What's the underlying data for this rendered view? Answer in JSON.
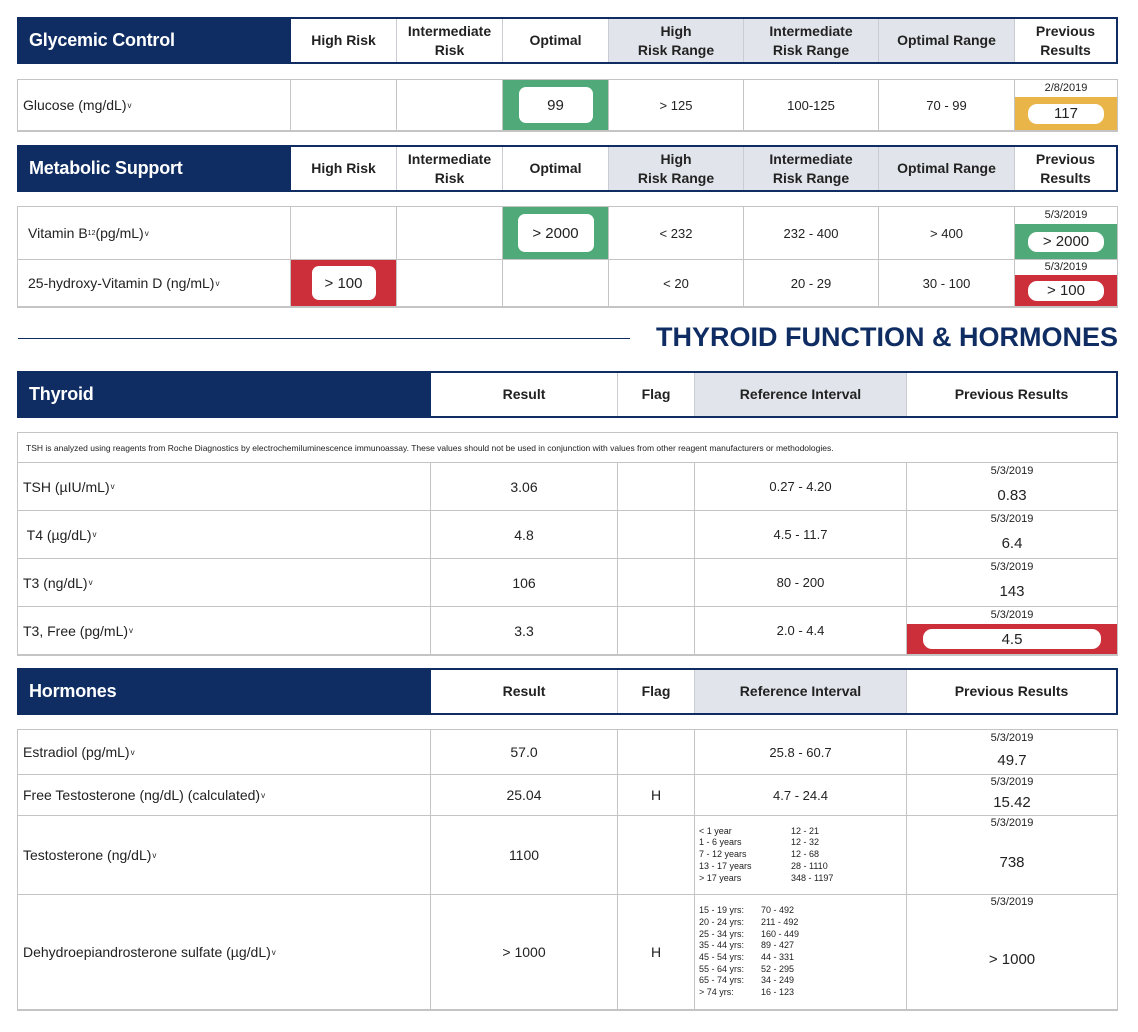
{
  "glycemic": {
    "title": "Glycemic Control",
    "headers": [
      "High Risk",
      "Intermediate\nRisk",
      "Optimal",
      "High\nRisk Range",
      "Intermediate\nRisk Range",
      "Optimal Range",
      "Previous\nResults"
    ],
    "rows": [
      {
        "name": "Glucose (mg/dL)",
        "sup": "v",
        "category": "Optimal",
        "value": "99",
        "high_range": "> 125",
        "intermediate_range": "100-125",
        "optimal_range": "70 - 99",
        "prev_date": "2/8/2019",
        "prev_value": "117",
        "prev_status": "intermediate"
      }
    ]
  },
  "metabolic": {
    "title": "Metabolic Support",
    "headers": [
      "High Risk",
      "Intermediate\nRisk",
      "Optimal",
      "High\nRisk Range",
      "Intermediate\nRisk Range",
      "Optimal Range",
      "Previous\nResults"
    ],
    "rows": [
      {
        "name": "Vitamin B",
        "sub": "12",
        "unit": " (pg/mL)",
        "sup": "v",
        "category": "Optimal",
        "value": "> 2000",
        "high_range": "< 232",
        "intermediate_range": "232 - 400",
        "optimal_range": "> 400",
        "prev_date": "5/3/2019",
        "prev_value": "> 2000",
        "prev_status": "optimal"
      },
      {
        "name": "25-hydroxy-Vitamin D (ng/mL)",
        "sup": "v",
        "category": "High Risk",
        "value": "> 100",
        "high_range": "< 20",
        "intermediate_range": "20 - 29",
        "optimal_range": "30 - 100",
        "prev_date": "5/3/2019",
        "prev_value": "> 100",
        "prev_status": "high"
      }
    ]
  },
  "section_heading": "THYROID FUNCTION & HORMONES",
  "thyroid": {
    "title": "Thyroid",
    "headers": [
      "Result",
      "Flag",
      "Reference Interval",
      "Previous Results"
    ],
    "note": "TSH is analyzed using reagents from Roche Diagnostics by electrochemiluminescence immunoassay. These values should not be used in conjunction with values from other reagent manufacturers or methodologies.",
    "rows": [
      {
        "name": "TSH (µIU/mL)",
        "sup": "v",
        "result": "3.06",
        "flag": "",
        "reference": "0.27 - 4.20",
        "prev_date": "5/3/2019",
        "prev_value": "0.83",
        "prev_status": "normal"
      },
      {
        "name": " T4 (µg/dL)",
        "sup": "v",
        "result": "4.8",
        "flag": "",
        "reference": "4.5 - 11.7",
        "prev_date": "5/3/2019",
        "prev_value": "6.4",
        "prev_status": "normal"
      },
      {
        "name": "T3 (ng/dL)",
        "sup": "v",
        "result": "106",
        "flag": "",
        "reference": "80 - 200",
        "prev_date": "5/3/2019",
        "prev_value": "143",
        "prev_status": "normal"
      },
      {
        "name": "T3, Free (pg/mL)",
        "sup": "v",
        "result": "3.3",
        "flag": "",
        "reference": "2.0 - 4.4",
        "prev_date": "5/3/2019",
        "prev_value": "4.5",
        "prev_status": "high"
      }
    ]
  },
  "hormones": {
    "title": "Hormones",
    "headers": [
      "Result",
      "Flag",
      "Reference Interval",
      "Previous Results"
    ],
    "rows": [
      {
        "name": "Estradiol (pg/mL)",
        "sup": "v",
        "result": "57.0",
        "flag": "",
        "reference": "25.8 - 60.7",
        "prev_date": "5/3/2019",
        "prev_value": "49.7"
      },
      {
        "name": "Free Testosterone (ng/dL) (calculated)",
        "sup": "v",
        "result": "25.04",
        "flag": "H",
        "reference": "4.7 - 24.4",
        "prev_date": "5/3/2019",
        "prev_value": "15.42"
      },
      {
        "name": "Testosterone (ng/dL)",
        "sup": "v",
        "result": "1100",
        "flag": "",
        "reference_table": [
          [
            "< 1 year",
            "12 - 21"
          ],
          [
            "1 - 6 years",
            "12 - 32"
          ],
          [
            "7 - 12 years",
            "12 - 68"
          ],
          [
            "13 - 17 years",
            "28 - 1110"
          ],
          [
            "> 17 years",
            "348 - 1197"
          ]
        ],
        "prev_date": "5/3/2019",
        "prev_value": "738"
      },
      {
        "name": "Dehydroepiandrosterone sulfate (µg/dL)",
        "sup": "v",
        "result": "> 1000",
        "flag": "H",
        "reference_table": [
          [
            "15 - 19 yrs:",
            "70 - 492"
          ],
          [
            "20 - 24 yrs:",
            "211 - 492"
          ],
          [
            "25 - 34 yrs:",
            "160 - 449"
          ],
          [
            "35 - 44 yrs:",
            "89 - 427"
          ],
          [
            "45 - 54 yrs:",
            "44 - 331"
          ],
          [
            "55 - 64 yrs:",
            "52 - 295"
          ],
          [
            "65 - 74 yrs:",
            "34 - 249"
          ],
          [
            "> 74 yrs:",
            "16 - 123"
          ]
        ],
        "prev_date": "5/3/2019",
        "prev_value": "> 1000"
      }
    ]
  },
  "colors": {
    "navy": "#0f2d63",
    "optimal_green": "#4fa978",
    "high_red": "#cc2f3a",
    "intermediate_gold": "#e9b448",
    "header_shade": "#e1e5eb"
  }
}
